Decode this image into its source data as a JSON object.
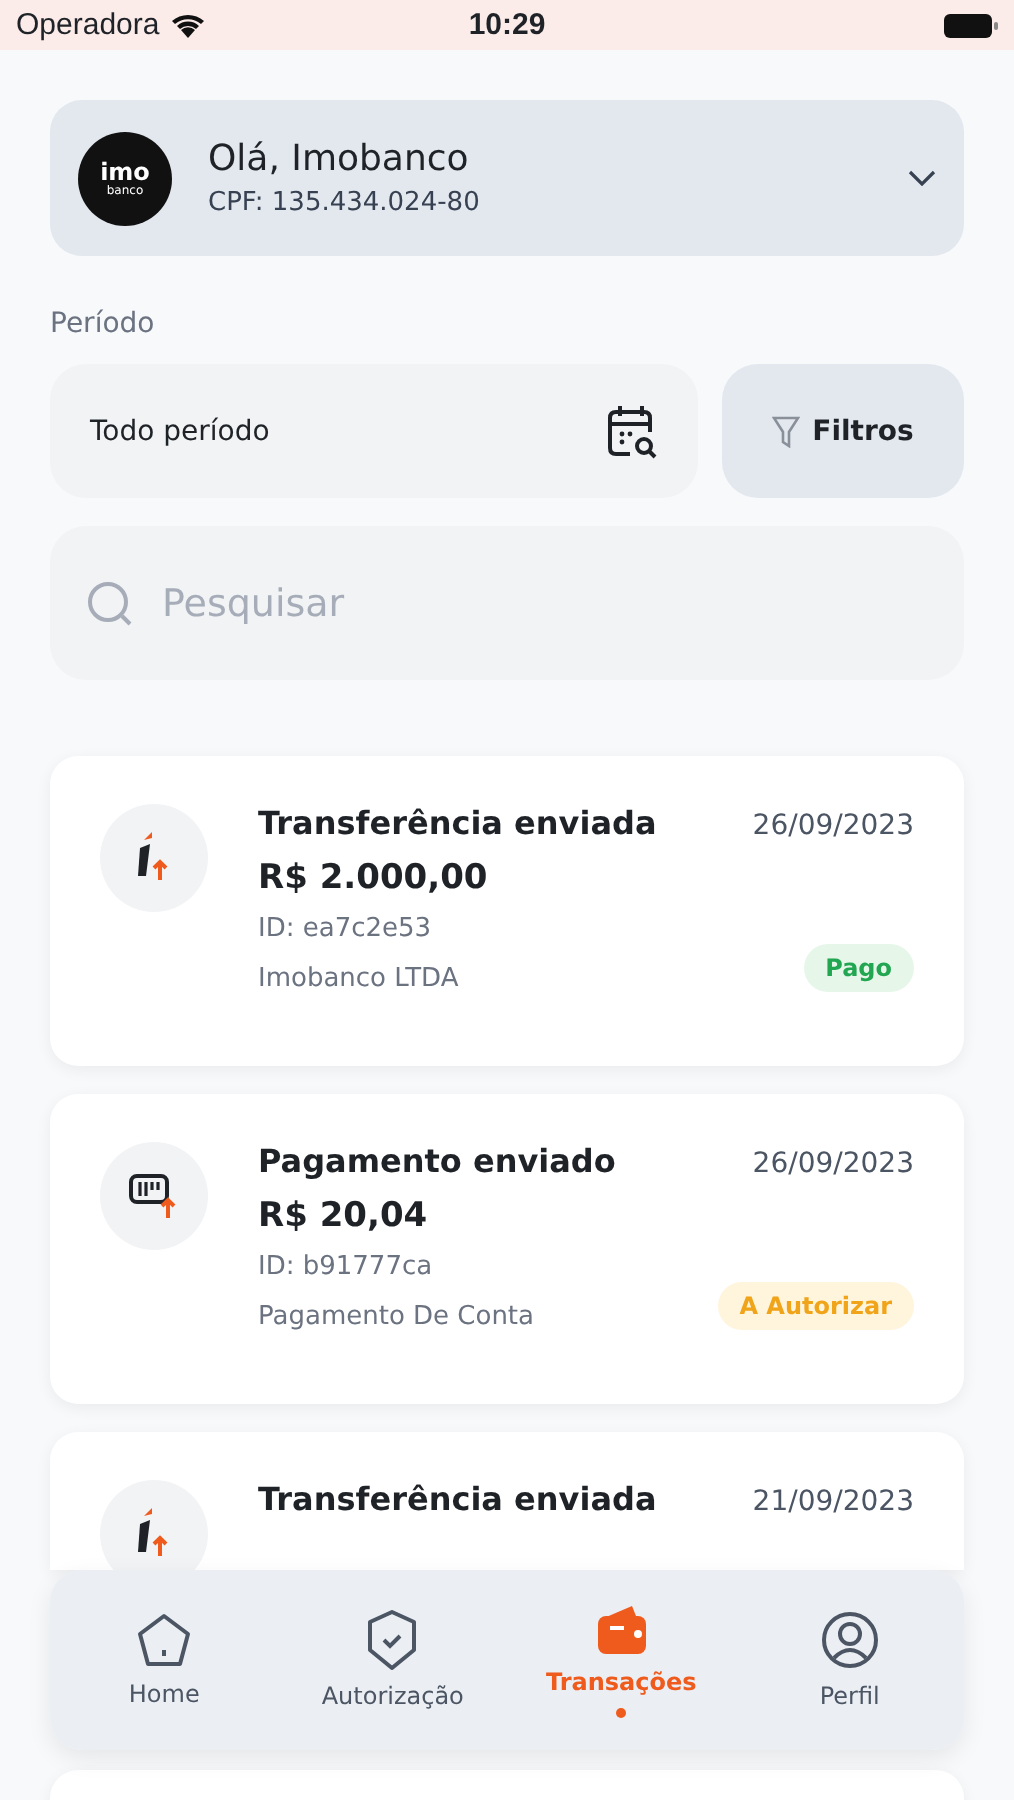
{
  "status_bar": {
    "carrier": "Operadora",
    "time": "10:29"
  },
  "account": {
    "logo_top": "imo",
    "logo_bottom": "banco",
    "greeting": "Olá, Imobanco",
    "cpf": "CPF: 135.434.024-80"
  },
  "period": {
    "label": "Período",
    "value": "Todo período",
    "filter_button": "Filtros"
  },
  "search": {
    "placeholder": "Pesquisar"
  },
  "transactions": [
    {
      "kind": "transfer",
      "title": "Transferência enviada",
      "date": "26/09/2023",
      "amount": "R$ 2.000,00",
      "id": "ID: ea7c2e53",
      "description": "Imobanco LTDA",
      "status": {
        "label": "Pago",
        "kind": "paid"
      }
    },
    {
      "kind": "payment",
      "title": "Pagamento enviado",
      "date": "26/09/2023",
      "amount": "R$ 20,04",
      "id": "ID: b91777ca",
      "description": "Pagamento De Conta",
      "status": {
        "label": "A Autorizar",
        "kind": "pending"
      }
    },
    {
      "kind": "transfer",
      "title": "Transferência enviada",
      "date": "21/09/2023"
    }
  ],
  "nav": [
    {
      "kind": "home",
      "label": "Home",
      "selected": false
    },
    {
      "kind": "shield",
      "label": "Autorização",
      "selected": false
    },
    {
      "kind": "wallet",
      "label": "Transações",
      "selected": true
    },
    {
      "kind": "person",
      "label": "Perfil",
      "selected": false
    }
  ]
}
